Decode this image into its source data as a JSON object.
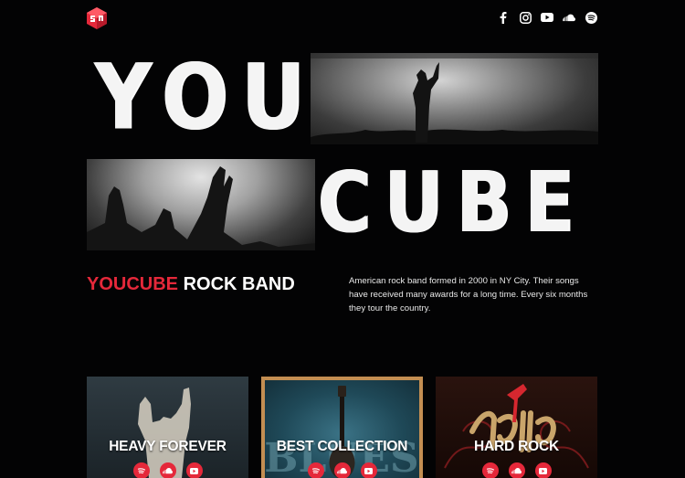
{
  "header": {
    "logo_icon": "cube-logo-icon",
    "social": [
      "facebook-icon",
      "instagram-icon",
      "youtube-icon",
      "soundcloud-icon",
      "spotify-icon"
    ]
  },
  "hero": {
    "word_top": "YOU",
    "word_bottom": "CUBE"
  },
  "intro": {
    "title_accent": "YOUCUBE",
    "title_rest": "ROCK BAND",
    "description": "American rock band formed in 2000 in NY City. Their songs have received many awards for a long time. Every six months they tour  the country."
  },
  "cards": [
    {
      "title": "HEAVY FOREVER",
      "icons": [
        "spotify-icon",
        "soundcloud-icon",
        "youtube-icon"
      ]
    },
    {
      "title": "BEST COLLECTION",
      "icons": [
        "spotify-icon",
        "soundcloud-icon",
        "youtube-icon"
      ]
    },
    {
      "title": "HARD ROCK",
      "icons": [
        "spotify-icon",
        "soundcloud-icon",
        "youtube-icon"
      ]
    }
  ],
  "colors": {
    "accent": "#e5283a",
    "background": "#030304",
    "text": "#ffffff"
  }
}
